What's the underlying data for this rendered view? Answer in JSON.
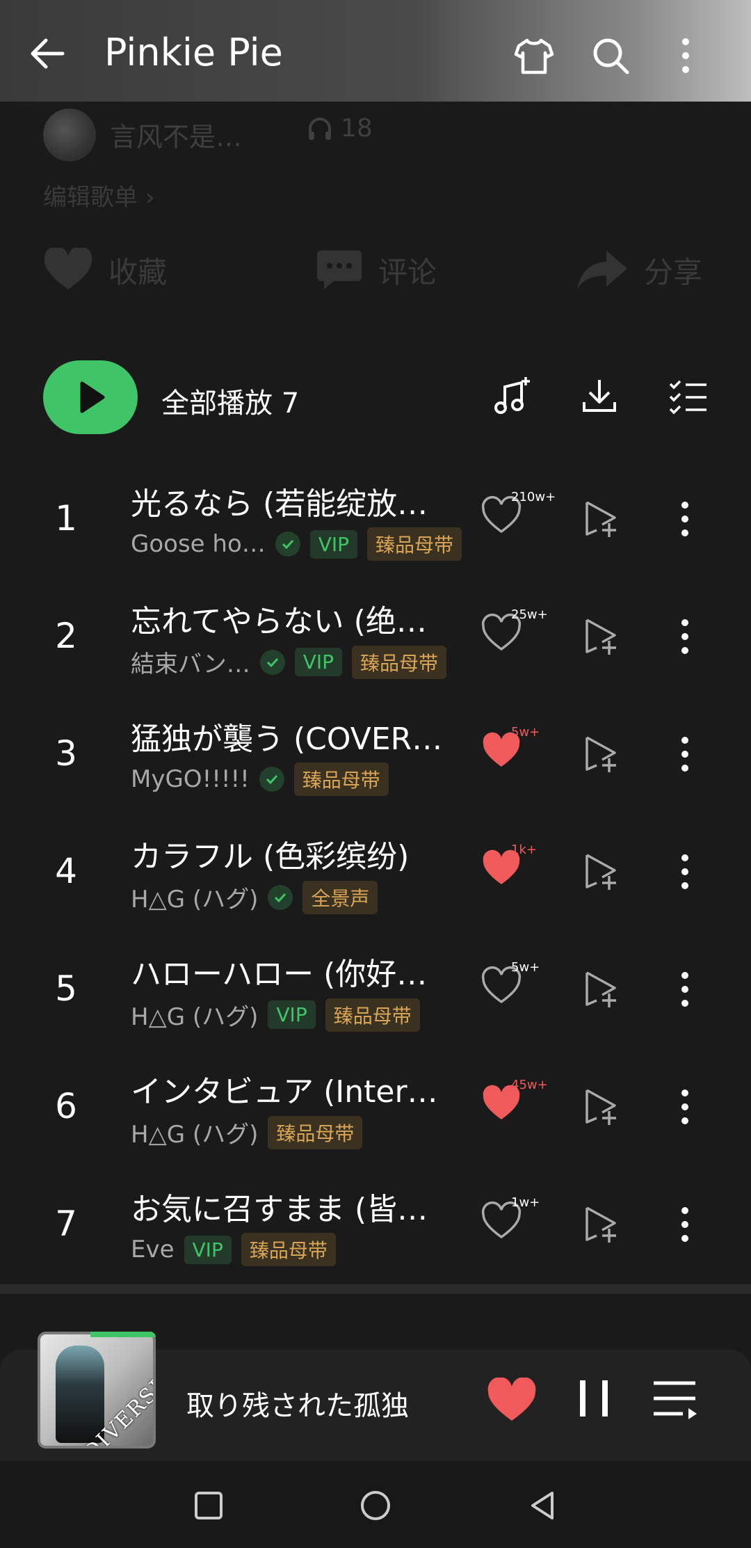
{
  "header": {
    "title": "Pinkie Pie",
    "back_icon": "arrow-left-icon",
    "icons": [
      "shirt-icon",
      "search-icon",
      "more-vertical-icon"
    ]
  },
  "creator": {
    "name": "言风不是…",
    "listen_count": "18"
  },
  "edit_playlist": "编辑歌单",
  "actions": {
    "collect": "收藏",
    "comment": "评论",
    "share": "分享"
  },
  "play_all": {
    "label": "全部播放",
    "count": "7"
  },
  "songs": [
    {
      "index": "1",
      "title": "光るなら (若能绽放…",
      "artist": "Goose ho…",
      "verified": true,
      "tags": [
        "VIP",
        "臻品母带"
      ],
      "likes": "210w+",
      "liked": false
    },
    {
      "index": "2",
      "title": "忘れてやらない (绝…",
      "artist": "結束バン…",
      "verified": true,
      "tags": [
        "VIP",
        "臻品母带"
      ],
      "likes": "25w+",
      "liked": false
    },
    {
      "index": "3",
      "title": "猛独が襲う (COVER…",
      "artist": "MyGO!!!!!",
      "verified": true,
      "tags": [
        "臻品母带"
      ],
      "likes": "5w+",
      "liked": true
    },
    {
      "index": "4",
      "title": "カラフル (色彩缤纷)",
      "artist": "H△G (ハグ)",
      "verified": true,
      "tags": [
        "全景声"
      ],
      "likes": "1k+",
      "liked": true
    },
    {
      "index": "5",
      "title": "ハローハロー (你好…",
      "artist": "H△G (ハグ)",
      "verified": false,
      "tags": [
        "VIP",
        "臻品母带"
      ],
      "likes": "5w+",
      "liked": false
    },
    {
      "index": "6",
      "title": "インタビュア (Inter…",
      "artist": "H△G (ハグ)",
      "verified": false,
      "tags": [
        "臻品母带"
      ],
      "likes": "45w+",
      "liked": true
    },
    {
      "index": "7",
      "title": "お気に召すまま (皆…",
      "artist": "Eve",
      "verified": false,
      "tags": [
        "VIP",
        "臻品母带"
      ],
      "likes": "1w+",
      "liked": false
    }
  ],
  "player": {
    "now_playing": "取り残された孤独",
    "cover_text": "DIVERSITY",
    "progress": 0.55,
    "liked": true
  },
  "colors": {
    "accent": "#3fc468",
    "heart": "#f05a5a",
    "gold_tag": "#d8a556"
  }
}
